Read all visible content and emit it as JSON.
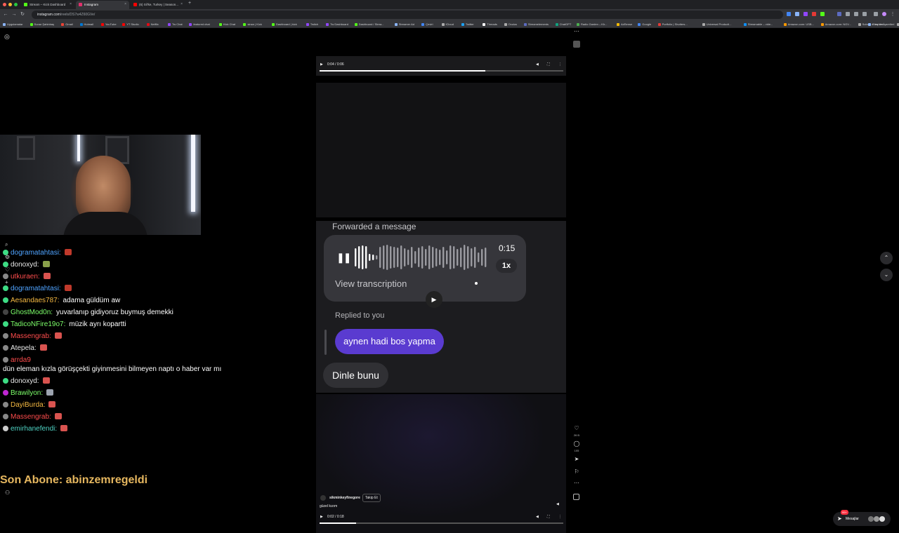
{
  "browser": {
    "tabs": [
      {
        "label": "Stream – Kick Dashboard",
        "color": "#53fc18",
        "active": false
      },
      {
        "label": "Instagram",
        "color": "#e1306c",
        "active": true
      },
      {
        "label": "(6) Sil'ke, Turkey | Season...",
        "color": "#ff0000",
        "active": false
      }
    ],
    "new_tab": "+",
    "url_host": "instagram.com",
    "url_path": "/reels/DS7w4Z60GVe/",
    "bookmarks": [
      {
        "label": "Uygulamalar",
        "color": "#8ab4f8"
      },
      {
        "label": "Sunar Şahinbaş",
        "color": "#53fc18"
      },
      {
        "label": "Gmail",
        "color": "#ea4335"
      },
      {
        "label": "Hotmail",
        "color": "#0078d4"
      },
      {
        "label": "YouTube",
        "color": "#ff0000"
      },
      {
        "label": "YT Studio",
        "color": "#ff0000"
      },
      {
        "label": "Netflix",
        "color": "#e50914"
      },
      {
        "label": "Tw Chat",
        "color": "#9146ff"
      },
      {
        "label": "featured chat",
        "color": "#9146ff"
      },
      {
        "label": "Kick Chat",
        "color": "#53fc18"
      },
      {
        "label": "sinan | Kick",
        "color": "#53fc18"
      },
      {
        "label": "Dashboard | kick",
        "color": "#53fc18"
      },
      {
        "label": "Twitch",
        "color": "#9146ff"
      },
      {
        "label": "Tw Dashboard",
        "color": "#9146ff"
      },
      {
        "label": "Dashboard / Strea...",
        "color": "#53fc18"
      },
      {
        "label": "Streamer Ad",
        "color": "#8ab4f8"
      },
      {
        "label": "Çeviri",
        "color": "#4285f4"
      },
      {
        "label": "iCloud",
        "color": "#aaaaaa"
      },
      {
        "label": "Twitter",
        "color": "#1da1f2"
      },
      {
        "label": "Threads",
        "color": "#ffffff"
      },
      {
        "label": "Oculus",
        "color": "#aaaaaa"
      },
      {
        "label": "Streamelements",
        "color": "#5c6bc0"
      },
      {
        "label": "ChatGPT",
        "color": "#10a37f"
      },
      {
        "label": "Radio Garden – Kh...",
        "color": "#4caf50"
      },
      {
        "label": "AdSense",
        "color": "#fbbc04"
      },
      {
        "label": "Google",
        "color": "#4285f4"
      },
      {
        "label": "Portfolio | Shutters...",
        "color": "#e53935"
      },
      {
        "label": "Universal Producti...",
        "color": "#aaaaaa"
      },
      {
        "label": "Streamable – vide...",
        "color": "#0f90fa"
      },
      {
        "label": "Amazon.com: USB...",
        "color": "#ff9900"
      },
      {
        "label": "Amazon.com: NGV...",
        "color": "#ff9900"
      },
      {
        "label": "Submit a request...",
        "color": "#aaaaaa"
      },
      {
        "label": "Drive & Listen",
        "color": "#aaaaaa"
      }
    ],
    "all_bookmarks": "Tüm Yer İşaretleri"
  },
  "chat": {
    "messages": [
      {
        "user": "dogramatahtasi:",
        "color": "#4fa3ff",
        "badge": "#3ddc84",
        "text": "",
        "emote": "#c0392b"
      },
      {
        "user": "donoxyd:",
        "color": "#e8e8e8",
        "badge": "#3ddc84",
        "text": "",
        "emote": "#8aa04a"
      },
      {
        "user": "utkuraen:",
        "color": "#ff4d4d",
        "badge": "#888888",
        "text": "",
        "emote": "#d9534f"
      },
      {
        "user": "dogramatahtasi:",
        "color": "#4fa3ff",
        "badge": "#3ddc84",
        "text": "",
        "emote": "#c0392b"
      },
      {
        "user": "Aesandaes787:",
        "color": "#f5b942",
        "badge": "#3ddc84",
        "text": "adama güldüm aw",
        "emote": ""
      },
      {
        "user": "GhostMod0n:",
        "color": "#7dff6a",
        "badge": "#444444",
        "text": "yuvarlanıp gidiyoruz buymuş demekki",
        "emote": ""
      },
      {
        "user": "TadicoNFire19o7:",
        "color": "#7dff6a",
        "badge": "#3ddc84",
        "text": "müzik ayrı kopartti",
        "emote": ""
      },
      {
        "user": "Massengrab:",
        "color": "#ff4d4d",
        "badge": "#888888",
        "text": "",
        "emote": "#d9534f"
      },
      {
        "user": "Atepela:",
        "color": "#e8e8e8",
        "badge": "#888888",
        "text": "",
        "emote": "#d9534f"
      },
      {
        "user": "arrda9",
        "color": "#ff4d4d",
        "badge": "#888888",
        "text": "",
        "emote": ""
      },
      {
        "user": "",
        "color": "#e8e8e8",
        "badge": "",
        "text": "dün eleman kızla görüşçekti giyinmesini bilmeyen naptı o haber var mı",
        "emote": ""
      },
      {
        "user": "donoxyd:",
        "color": "#e8e8e8",
        "badge": "#3ddc84",
        "text": "",
        "emote": "#d9534f"
      },
      {
        "user": "Brawilyon:",
        "color": "#7dff6a",
        "badge": "#c026d3",
        "text": "",
        "emote": "#9ca3af"
      },
      {
        "user": "DayiBurda:",
        "color": "#f5b942",
        "badge": "#888888",
        "text": "",
        "emote": "#d9534f"
      },
      {
        "user": "Massengrab:",
        "color": "#ff4d4d",
        "badge": "#888888",
        "text": "",
        "emote": "#d9534f"
      },
      {
        "user": "emirhanefendi:",
        "color": "#4fd3c4",
        "badge": "#cccccc",
        "text": "",
        "emote": "#d9534f"
      }
    ]
  },
  "overlay": {
    "last_sub": "Son Abone: abinzemregeldi"
  },
  "post": {
    "top_video": {
      "time": "0:04 / 0:06",
      "progress": 0.68
    },
    "dm": {
      "forwarded": "Forwarded a message",
      "voice_duration": "0:15",
      "speed": "1x",
      "view_transcription": "View transcription",
      "replied_to_you": "Replied to you",
      "reply_text": "aynen hadi bos yapma",
      "message_text": "Dinle bunu"
    },
    "bottom_video": {
      "username": "sikminkeyfinegore",
      "follow": "Takip Et",
      "caption": "güzel kızım",
      "time": "0:02 / 0:18",
      "progress": 0.15
    },
    "likes": "26 B",
    "comments": "105"
  },
  "messages_pill": {
    "label": "Mesajlar",
    "badge": "99+"
  }
}
